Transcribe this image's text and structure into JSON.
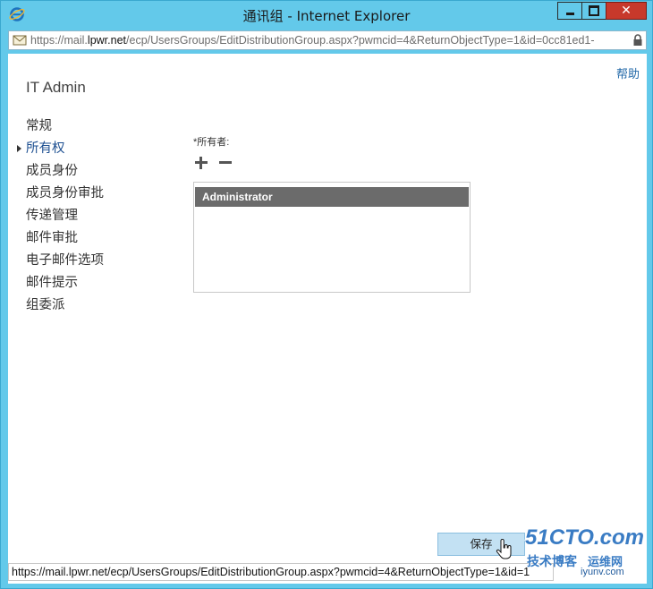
{
  "window": {
    "title": "通讯组 - Internet Explorer",
    "minimize_label": "",
    "maximize_label": "",
    "close_label": "✕"
  },
  "address_bar": {
    "url_prefix": "https://mail.",
    "url_host": "lpwr.net",
    "url_path": "/ecp/UsersGroups/EditDistributionGroup.aspx?pwmcid=4&ReturnObjectType=1&id=0cc81ed1-"
  },
  "page": {
    "help_link": "帮助",
    "org_name": "IT Admin",
    "nav_items": [
      {
        "label": "常规",
        "active": false
      },
      {
        "label": "所有权",
        "active": true
      },
      {
        "label": "成员身份",
        "active": false
      },
      {
        "label": "成员身份审批",
        "active": false
      },
      {
        "label": "传递管理",
        "active": false
      },
      {
        "label": "邮件审批",
        "active": false
      },
      {
        "label": "电子邮件选项",
        "active": false
      },
      {
        "label": "邮件提示",
        "active": false
      },
      {
        "label": "组委派",
        "active": false
      }
    ],
    "owners_label": "*所有者:",
    "owners": [
      "Administrator"
    ],
    "save_button": "保存"
  },
  "status_bar": {
    "text": "https://mail.lpwr.net/ecp/UsersGroups/EditDistributionGroup.aspx?pwmcid=4&ReturnObjectType=1&id=1"
  },
  "watermark": {
    "brand": "51CTO.com",
    "tagline": "技术博客",
    "tagline2": "运维网",
    "url": "iyunv.com"
  },
  "colors": {
    "frame": "#63c9ea",
    "active_nav": "#1d4f91",
    "selected_row": "#6b6b6b",
    "save_button": "#c3e1f3",
    "close_button": "#c7392b"
  },
  "icons": {
    "app": "internet-explorer-icon",
    "address": "mail-icon",
    "lock": "lock-icon",
    "add": "plus-icon",
    "remove": "minus-icon",
    "cursor": "hand-cursor-icon"
  }
}
